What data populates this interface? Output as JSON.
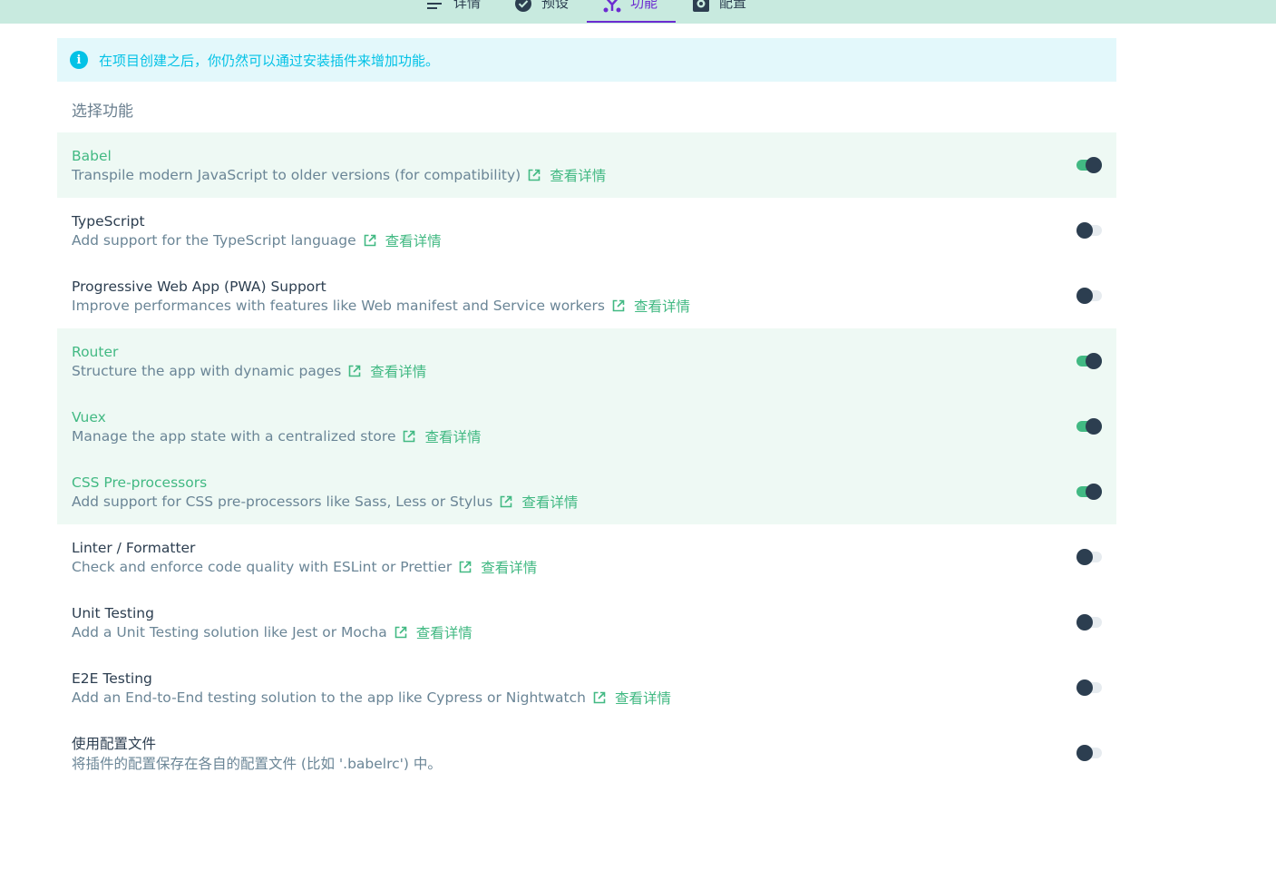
{
  "tabs": [
    {
      "label": "详情",
      "icon": "list-icon",
      "active": false
    },
    {
      "label": "预设",
      "icon": "check-circle-icon",
      "active": false
    },
    {
      "label": "功能",
      "icon": "fork-icon",
      "active": true
    },
    {
      "label": "配置",
      "icon": "gear-icon",
      "active": false
    }
  ],
  "colors": {
    "accent": "#42b983",
    "active_tab": "#6c2bd0",
    "info": "#03c2e6",
    "topbar": "#c8eadf"
  },
  "info": {
    "icon": "info-icon",
    "text": "在项目创建之后，你仍然可以通过安装插件来增加功能。"
  },
  "section_title": "选择功能",
  "link_label": "查看详情",
  "features": [
    {
      "name": "Babel",
      "desc": "Transpile modern JavaScript to older versions (for compatibility)",
      "enabled": true,
      "has_link": true
    },
    {
      "name": "TypeScript",
      "desc": "Add support for the TypeScript language",
      "enabled": false,
      "has_link": true
    },
    {
      "name": "Progressive Web App (PWA) Support",
      "desc": "Improve performances with features like Web manifest and Service workers",
      "enabled": false,
      "has_link": true
    },
    {
      "name": "Router",
      "desc": "Structure the app with dynamic pages",
      "enabled": true,
      "has_link": true
    },
    {
      "name": "Vuex",
      "desc": "Manage the app state with a centralized store",
      "enabled": true,
      "has_link": true
    },
    {
      "name": "CSS Pre-processors",
      "desc": "Add support for CSS pre-processors like Sass, Less or Stylus",
      "enabled": true,
      "has_link": true
    },
    {
      "name": "Linter / Formatter",
      "desc": "Check and enforce code quality with ESLint or Prettier",
      "enabled": false,
      "has_link": true
    },
    {
      "name": "Unit Testing",
      "desc": "Add a Unit Testing solution like Jest or Mocha",
      "enabled": false,
      "has_link": true
    },
    {
      "name": "E2E Testing",
      "desc": "Add an End-to-End testing solution to the app like Cypress or Nightwatch",
      "enabled": false,
      "has_link": true
    },
    {
      "name": "使用配置文件",
      "desc": "将插件的配置保存在各自的配置文件 (比如 '.babelrc') 中。",
      "enabled": false,
      "has_link": false
    }
  ]
}
